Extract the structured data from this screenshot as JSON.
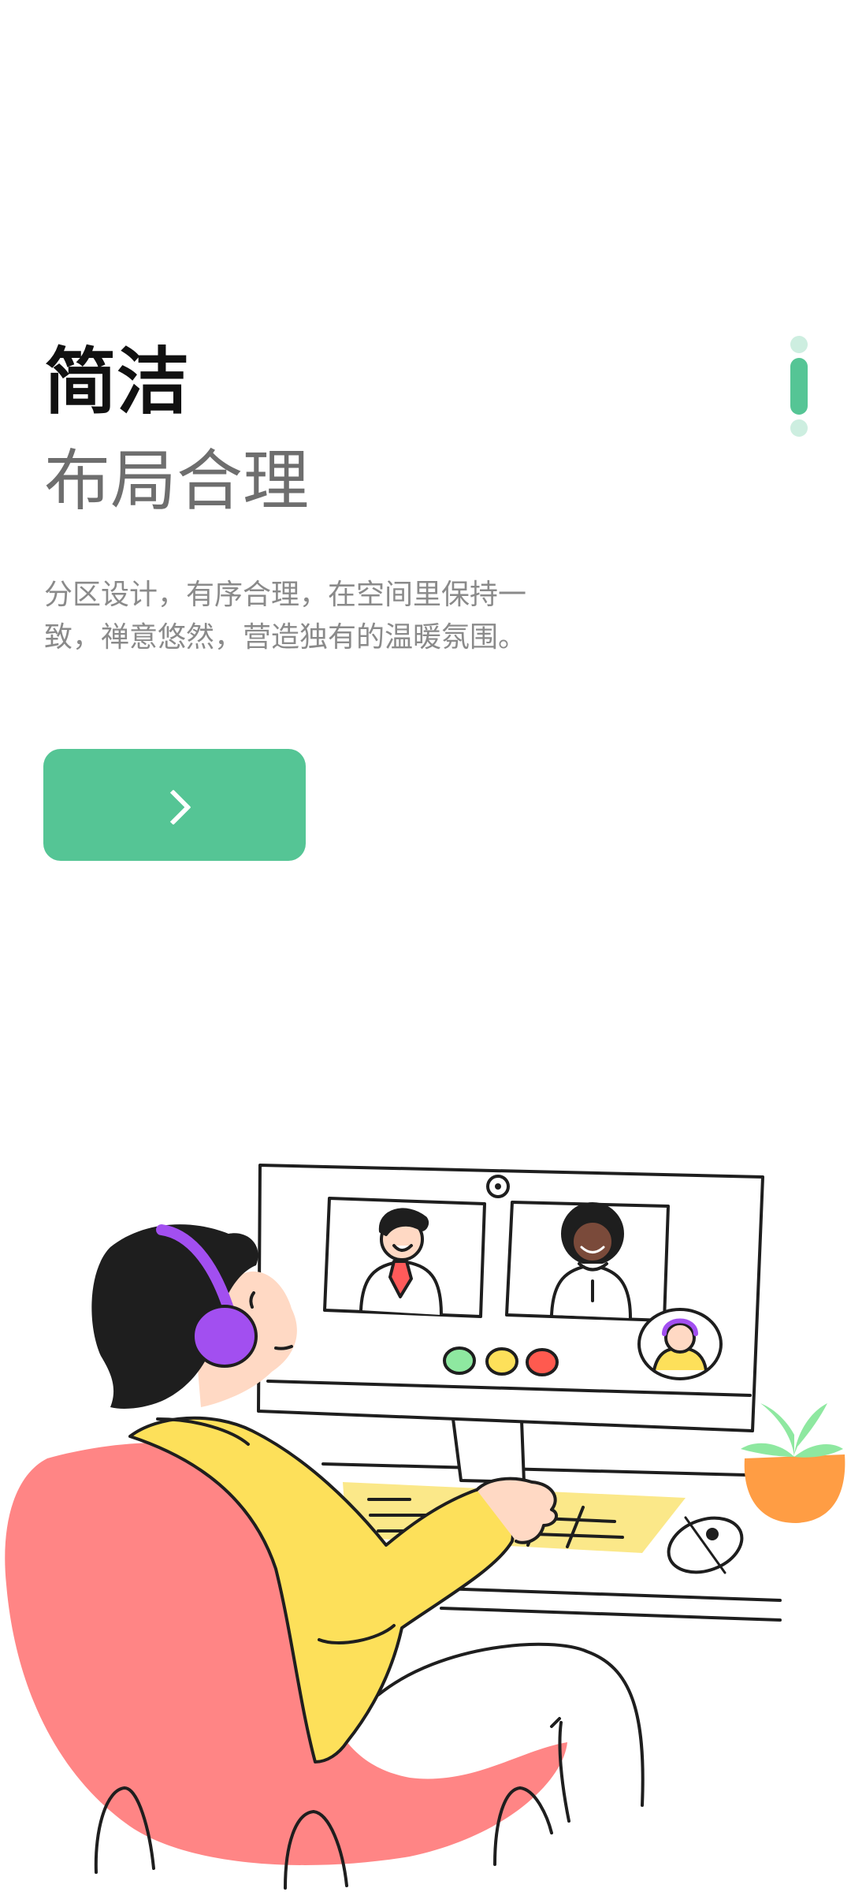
{
  "onboarding": {
    "title": "简洁",
    "subtitle": "布局合理",
    "description": "分区设计，有序合理，在空间里保持一致，禅意悠然，营造独有的温暖氛围。",
    "next_button_icon": "chevron-right-icon",
    "page_indicator": {
      "total_pages": 3,
      "current_page": 2
    }
  },
  "colors": {
    "accent": "#55c595",
    "accent_light": "#cdeee0",
    "title": "#111111",
    "subtitle": "#6e6e6e",
    "description": "#8a8a8a",
    "chair": "#ff8585",
    "shirt": "#fde05a",
    "headphones": "#a24ff0",
    "plant_pot": "#ff9d44"
  }
}
